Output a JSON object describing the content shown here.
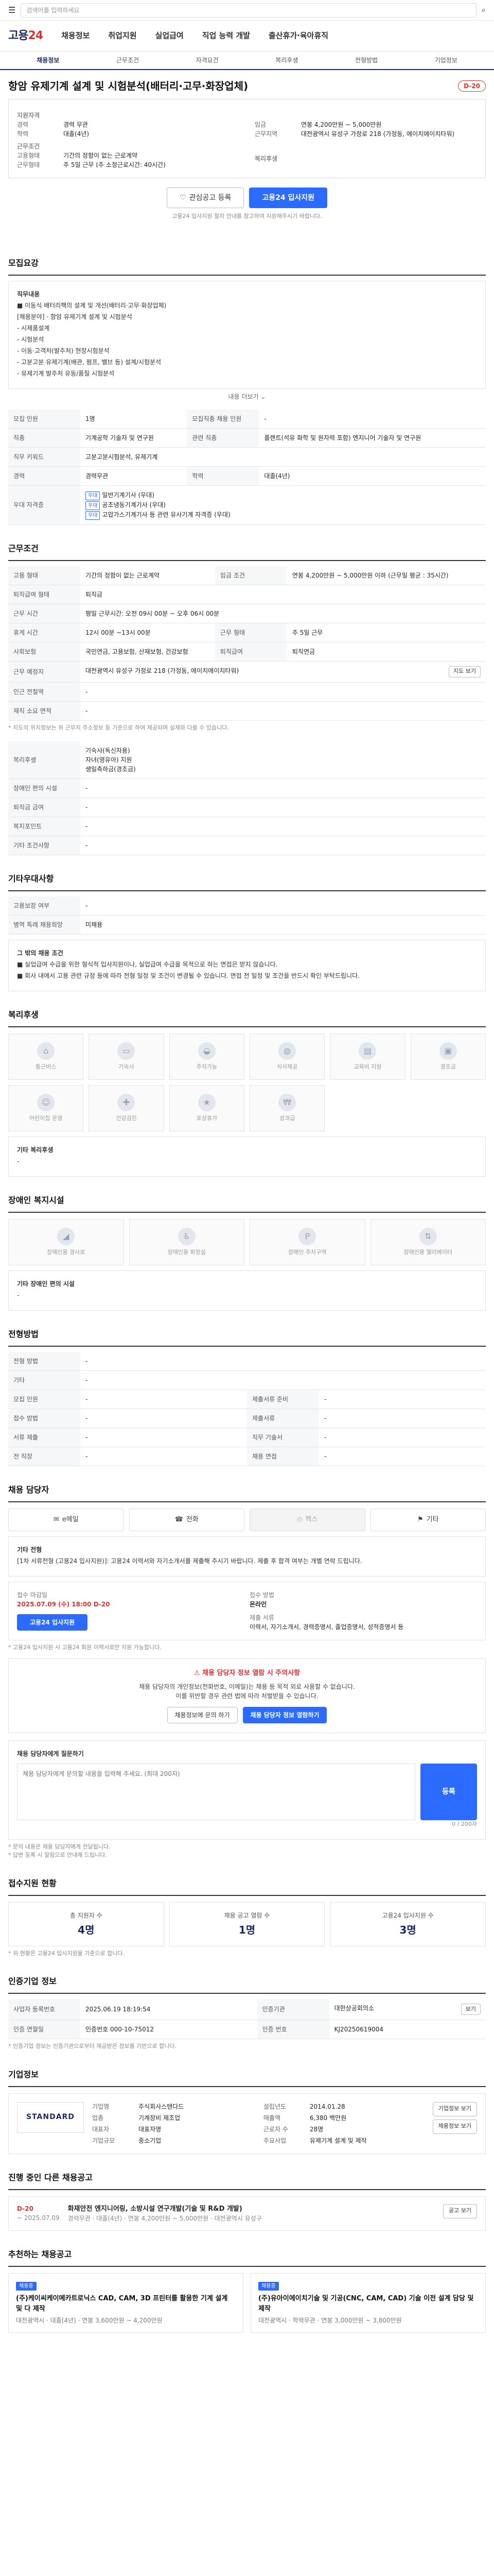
{
  "topbar": {
    "search_placeholder": "검색어를 입력하세요"
  },
  "header": {
    "logo_main": "고용",
    "logo_sub": "24",
    "gnb": [
      "채용정보",
      "취업지원",
      "실업급여",
      "직업 능력 개발",
      "출산휴가·육아휴직"
    ],
    "gnb_right": "로그인 · 회원가입"
  },
  "subnav": [
    "채용정보",
    "근무조건",
    "자격요건",
    "복리후생",
    "전형방법",
    "기업정보"
  ],
  "job": {
    "title": "항암 유제기계 설계 및 시험분석(배터리·고무·화장업체)",
    "dday": "D-20",
    "summary": {
      "group1": "지원자격",
      "career_label": "경력",
      "career": "경력 무관",
      "edu_label": "학력",
      "edu": "대졸(4년)",
      "group2": "근무조건",
      "type_label": "고용형태",
      "type": "기간의 정함이 없는 근로계약",
      "hours_label": "근무형태",
      "hours": "주 5일 근무 (주 소정근로시간: 40시간)",
      "wage_label": "임금",
      "wage": "연봉 4,200만원 ~ 5,000만원",
      "loc_label": "근무지역",
      "loc": "대전광역시 유성구 가정로 218 (가정동, 에이치에이치타워)",
      "group3": "복리후생"
    }
  },
  "actions": {
    "bookmark": "관심공고 등록",
    "apply": "고용24 입사지원",
    "note": "고용24 입사지원 절차 안내를 참고하여 지원해주시기 바랍니다."
  },
  "sections": {
    "recruit": "모집요강",
    "work": "근무조건",
    "benefit": "복리후생",
    "disability": "장애인 복지시설",
    "elder": "기타우대사항",
    "method": "전형방법",
    "contact": "채용 담당자",
    "status": "접수지원 현황",
    "trust": "인증기업 정보",
    "company": "기업정보",
    "other": "진행 중인 다른 채용공고",
    "recommend": "추천하는 채용공고"
  },
  "recruit": {
    "duty_title": "직무내용",
    "duties": [
      "■ 이동식 배터리팩의 설계 및 개선(배터리·고무·화장업체)",
      "[채용분야] · 항암 유제기계 설계 및 시험분석",
      "- 시제품설계",
      "- 시험분석",
      "- 이동·고객처(발주처) 현장시험분석",
      "- 고분고분 유제기계(배관, 펌프, 밸브 등) 설계/시험분석",
      "- 유제기계 발주처 유동/품질 시험분석"
    ],
    "more": "내용 더보기",
    "rows": [
      {
        "k": "모집 인원",
        "v": "1명",
        "k2": "모집직종 채용 인원",
        "v2": "-"
      },
      {
        "k": "직종",
        "v": "기계공학 기술자 및 연구원",
        "k2": "관련 직종",
        "v2": "플랜트(석유 화학 및 원자력 포함) 엔지니어 기술자 및 연구원"
      },
      {
        "k": "직무 키워드",
        "v": "고분고분시험분석, 유제기계",
        "k2": "",
        "v2": ""
      },
      {
        "k": "경력",
        "v": "경력무관",
        "k2": "학력",
        "v2": "대졸(4년)"
      }
    ],
    "license_label": "우대 자격증",
    "license_tags": [
      "필수",
      "우대"
    ],
    "license_lines": [
      "일반기계기사 (우대)",
      "공조냉동기계기사 (우대)",
      "고압가스기계기사 등 관련 유사기계 자격증 (우대)"
    ]
  },
  "work": {
    "rows": [
      {
        "k": "고용 형태",
        "v": "기간의 정함이 없는 근로계약",
        "k2": "임금 조건",
        "v2": "연봉 4,200만원 ~ 5,000만원 이하 (근무일 평균 : 35시간)"
      },
      {
        "k": "퇴직급여 형태",
        "v": "퇴직금",
        "k2": "",
        "v2": ""
      },
      {
        "k": "근무 시간",
        "v": "평일 근무시간: 오전 09시 00분 ~ 오후 06시 00분",
        "k2": "",
        "v2": ""
      },
      {
        "k": "휴게 시간",
        "v": "12시 00분 ~13시 00분",
        "k2": "근무 형태",
        "v2": "주 5일 근무"
      },
      {
        "k": "사회보험",
        "v": "국민연금, 고용보험, 산재보험, 건강보험",
        "k2": "퇴직급여",
        "v2": "퇴직연금"
      },
      {
        "k": "근무 예정지",
        "v": "대전광역시 유성구 가정로 218 (가정동, 에이치에이치타워)",
        "k2": "",
        "v2": ""
      },
      {
        "k": "인근 전철역",
        "v": "-",
        "k2": "",
        "v2": ""
      },
      {
        "k": "재직 소요 면적",
        "v": "-",
        "k2": "",
        "v2": ""
      }
    ],
    "map_btn": "지도 보기",
    "footnote": "* 지도의 위치정보는 위 근무지 주소정보 등 기준으로 하여 제공되며 실제와 다를 수 있습니다."
  },
  "welfare_rows": [
    {
      "k": "복리후생",
      "v": "기숙사(독신자용)\n자녀(영유아) 지원\n생일축하금(경조금)"
    },
    {
      "k": "장애인 편의 시설",
      "v": "-"
    },
    {
      "k": "퇴직금 금여",
      "v": "-"
    },
    {
      "k": "복지포인트",
      "v": "-"
    },
    {
      "k": "기타 조건사항",
      "v": "-"
    }
  ],
  "elder": {
    "rows": [
      {
        "k": "고용보장 여부",
        "v": "-"
      },
      {
        "k": "병역 특례 채용희망",
        "v": "미채용"
      }
    ],
    "etc_title": "그 밖의 채용 조건",
    "etc_lines": [
      "■ 실업급여 수급을 위한 형식적 입사지원이나, 실업급여 수급을 목적으로 하는 면접은 받지 않습니다.",
      "■ 회사 내에서 고용 관련 규정 등에 따라 전형 일정 및 조건이 변경될 수 있습니다. 면접 전 일정 및 조건을 반드시 확인 부탁드립니다."
    ]
  },
  "benefit_icons": [
    {
      "icon": "home-icon",
      "label": "통근버스"
    },
    {
      "icon": "bed-icon",
      "label": "기숙사"
    },
    {
      "icon": "car-icon",
      "label": "주차가능"
    },
    {
      "icon": "food-icon",
      "label": "식사제공"
    },
    {
      "icon": "book-icon",
      "label": "교육비 지원"
    },
    {
      "icon": "gift-icon",
      "label": "경조금"
    },
    {
      "icon": "baby-icon",
      "label": "어린이집 운영"
    },
    {
      "icon": "health-icon",
      "label": "건강검진"
    },
    {
      "icon": "trophy-icon",
      "label": "포상휴가"
    },
    {
      "icon": "money-icon",
      "label": "성과급"
    }
  ],
  "benefit_etc": {
    "label": "기타 복리후생",
    "value": "-"
  },
  "disability_icons": [
    {
      "icon": "ramp-icon",
      "label": "장애인용 경사로"
    },
    {
      "icon": "toilet-icon",
      "label": "장애인용 화장실"
    },
    {
      "icon": "parking-icon",
      "label": "장애인 주차구역"
    },
    {
      "icon": "elevator-icon",
      "label": "장애인용 엘리베이터"
    }
  ],
  "disability_etc": {
    "label": "기타 장애인 편의 시설",
    "value": "-"
  },
  "method": {
    "rows": [
      {
        "k": "전형 방법",
        "v": "-",
        "k2": "",
        "v2": ""
      },
      {
        "k": "기타",
        "v": "-",
        "k2": "",
        "v2": ""
      },
      {
        "k": "모집 인원",
        "v": "-",
        "k2": "제출서류 준비",
        "v2": "-"
      },
      {
        "k": "접수 방법",
        "v": "-",
        "k2": "제출서류",
        "v2": "-"
      },
      {
        "k": "서류 제출",
        "v": "-",
        "k2": "직무 기술서",
        "v2": "-"
      },
      {
        "k": "전 직장",
        "v": "-",
        "k2": "채용 면접",
        "v2": "-"
      }
    ]
  },
  "contact": {
    "tabs": [
      {
        "icon": "mail-icon",
        "label": "e메일"
      },
      {
        "icon": "phone-icon",
        "label": "전화"
      },
      {
        "icon": "fax-icon",
        "label": "팩스"
      },
      {
        "icon": "visit-icon",
        "label": "기타"
      }
    ],
    "etc_title": "기타 전형",
    "etc_text": "[1차 서류전형 (고용24 입사지원)]: 고용24 이력서와 자기소개서를 제출해 주시기 바랍니다. 제출 후 합격 여부는 개별 연락 드립니다.",
    "apply_period_label": "접수 마감일",
    "apply_period": "2025.07.09 (수) 18:00",
    "apply_dday": "D-20",
    "apply_method_label": "접수 방법",
    "apply_method": "온라인",
    "channel_label": "제출 서류",
    "channel": "이력서, 자기소개서, 경력증명서, 졸업증명서, 성적증명서 등",
    "apply_btn": "고용24 입사지원",
    "notice": "* 고용24 입사지원 시 고용24 회원 이력서로만 지원 가능합니다."
  },
  "warn": {
    "title": "채용 담당자 정보 열람 시 주의사항",
    "text1": "채용 담당자의 개인정보(전화번호, 이메일)는 채용 등 목적 외로 사용할 수 없습니다.",
    "text2": "이를 위반할 경우 관련 법에 따라 처벌받을 수 있습니다.",
    "btn1": "채용정보에 문의 하기",
    "btn2": "채용 담당자 정보 열람하기"
  },
  "inquiry": {
    "label": "채용 담당자에게 질문하기",
    "placeholder": "채용 담당자에게 문의할 내용을 입력해 주세요. (최대 200자)",
    "count": "0 / 200자",
    "btn": "등록",
    "notes": [
      "* 문의 내용은 채용 담당자에게 전달됩니다.",
      "* 답변 등록 시 알림으로 안내해 드립니다."
    ]
  },
  "status": {
    "cards": [
      {
        "label": "총 지원자 수",
        "value": "4명"
      },
      {
        "label": "채용 공고 열람 수",
        "value": "1명"
      },
      {
        "label": "고용24 입사지원 수",
        "value": "3명"
      }
    ],
    "note": "* 위 현황은 고용24 입사지원을 기준으로 합니다."
  },
  "trust": {
    "rows": [
      {
        "k": "사업자 등록번호",
        "v": "2025.06.19 18:19:54",
        "k2": "인증기관",
        "v2": "대한상공회의소"
      },
      {
        "k": "인증 연월일",
        "v": "인증번호 000-10-75012",
        "k2": "인증 번호",
        "v2": "KJ20250619004"
      }
    ],
    "view_btn": "보기",
    "note": "* 인증기업 정보는 인증기관으로부터 제공받은 정보를 기반으로 합니다."
  },
  "company": {
    "logo": "STANDARD",
    "rows": [
      {
        "k": "기업명",
        "v": "주식회사스탠다드"
      },
      {
        "k": "설립년도",
        "v": "2014.01.28"
      },
      {
        "k": "업종",
        "v": "기계장비 제조업"
      },
      {
        "k": "매출액",
        "v": "6,380 백만원"
      },
      {
        "k": "대표자",
        "v": "대표자명"
      },
      {
        "k": "근로자 수",
        "v": "28명"
      },
      {
        "k": "기업규모",
        "v": "중소기업"
      },
      {
        "k": "주요사업",
        "v": "유제기계 설계 및 제작"
      }
    ],
    "btn1": "기업정보 보기",
    "btn2": "채용정보 보기"
  },
  "other": {
    "dday": "D-20",
    "period": "~ 2025.07.09",
    "title": "화재안전 엔지니어링, 소방시설 연구개발(기술 및 R&D 개발)",
    "meta": "경력무관 · 대졸(4년) · 연봉 4,200만원 ~ 5,000만원 · 대전광역시 유성구",
    "btn": "공고 보기"
  },
  "recommend": [
    {
      "badge": "채용중",
      "title": "(주)케이씨케이메카트로닉스 CAD, CAM, 3D 프린터를 활용한 기계 설계 및 다 제작",
      "meta": "대전광역시 · 대졸(4년) · 연봉 3,600만원 ~ 4,200만원"
    },
    {
      "badge": "채용중",
      "title": "(주)유아이에이치기술 및 기공(CNC, CAM, CAD) 기술 이전 설계 담당 및 제작",
      "meta": "대전광역시 · 학력무관 · 연봉 3,000만원 ~ 3,800만원"
    }
  ]
}
